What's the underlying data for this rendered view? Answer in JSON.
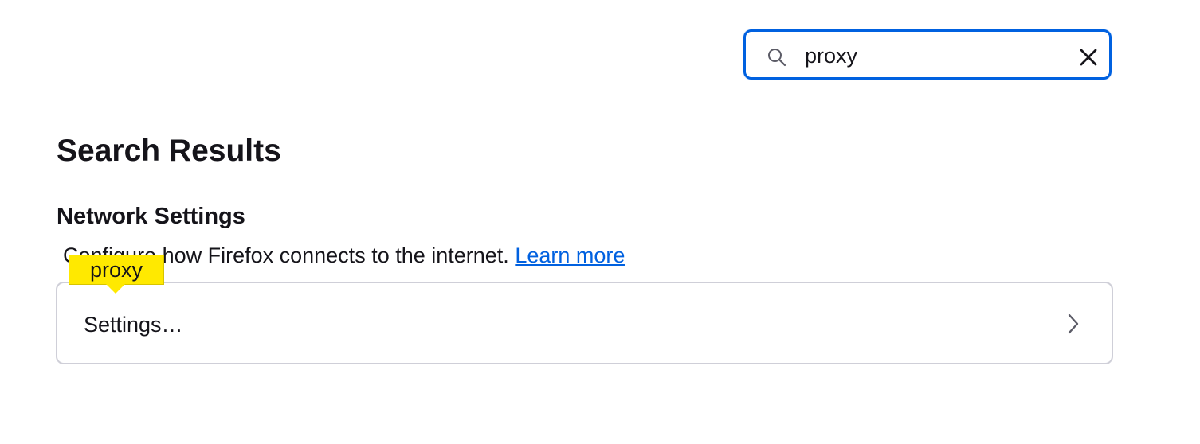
{
  "search": {
    "value": "proxy",
    "clear_icon": "close-icon",
    "search_icon": "search-icon"
  },
  "results": {
    "title": "Search Results"
  },
  "network_section": {
    "title": "Network Settings",
    "description": "Configure how Firefox connects to the internet.",
    "learn_more": "Learn more",
    "tooltip": "proxy",
    "settings_button": "Settings…",
    "chevron_icon": "chevron-right-icon"
  },
  "colors": {
    "accent": "#0061e0",
    "highlight": "#ffe900",
    "text": "#15141a",
    "border": "#cfcfd8"
  }
}
